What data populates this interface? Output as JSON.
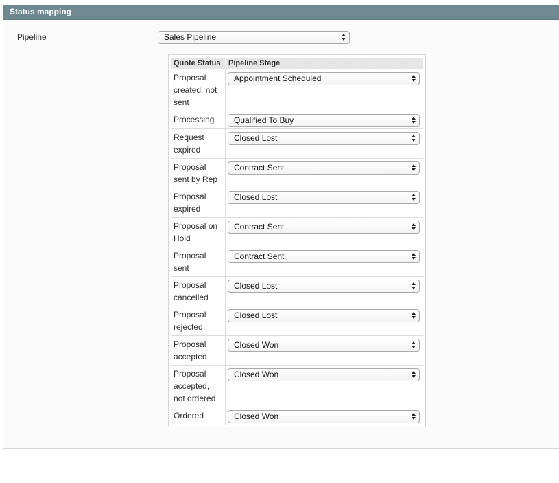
{
  "section": {
    "title": "Status mapping"
  },
  "pipeline": {
    "label": "Pipeline",
    "selected": "Sales Pipeline"
  },
  "table": {
    "headers": {
      "quote_status": "Quote Status",
      "pipeline_stage": "Pipeline Stage"
    },
    "rows": [
      {
        "status": "Proposal created, not sent",
        "stage": "Appointment Scheduled"
      },
      {
        "status": "Processing",
        "stage": "Qualified To Buy"
      },
      {
        "status": "Request expired",
        "stage": "Closed Lost"
      },
      {
        "status": "Proposal sent by Rep",
        "stage": "Contract Sent"
      },
      {
        "status": "Proposal expired",
        "stage": "Closed Lost"
      },
      {
        "status": "Proposal on Hold",
        "stage": "Contract Sent"
      },
      {
        "status": "Proposal sent",
        "stage": "Contract Sent"
      },
      {
        "status": "Proposal cancelled",
        "stage": "Closed Lost"
      },
      {
        "status": "Proposal rejected",
        "stage": "Closed Lost"
      },
      {
        "status": "Proposal accepted",
        "stage": "Closed Won"
      },
      {
        "status": "Proposal accepted, not ordered",
        "stage": "Closed Won"
      },
      {
        "status": "Ordered",
        "stage": "Closed Won"
      }
    ]
  },
  "icons": {
    "select_arrow": "updown-arrows-icon"
  },
  "colors": {
    "header_bar": "#6f8992",
    "panel_background": "#fafafa"
  }
}
